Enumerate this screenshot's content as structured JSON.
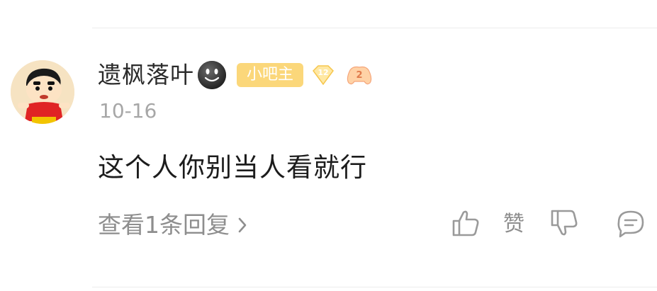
{
  "comment": {
    "username": "遗枫落叶",
    "badge": "小吧主",
    "level": "12",
    "game_level": "2",
    "date": "10-16",
    "content": "这个人你别当人看就行",
    "replies_label": "查看1条回复",
    "like_label": "赞"
  },
  "colors": {
    "badge_bg": "#fbd77a",
    "muted_text": "#8e8e8e",
    "date_text": "#a7a7a7"
  },
  "icons": [
    "smiley-icon",
    "level-diamond-icon",
    "gamepad-icon",
    "chevron-right-icon",
    "thumbs-up-icon",
    "thumbs-down-icon",
    "comment-icon"
  ]
}
